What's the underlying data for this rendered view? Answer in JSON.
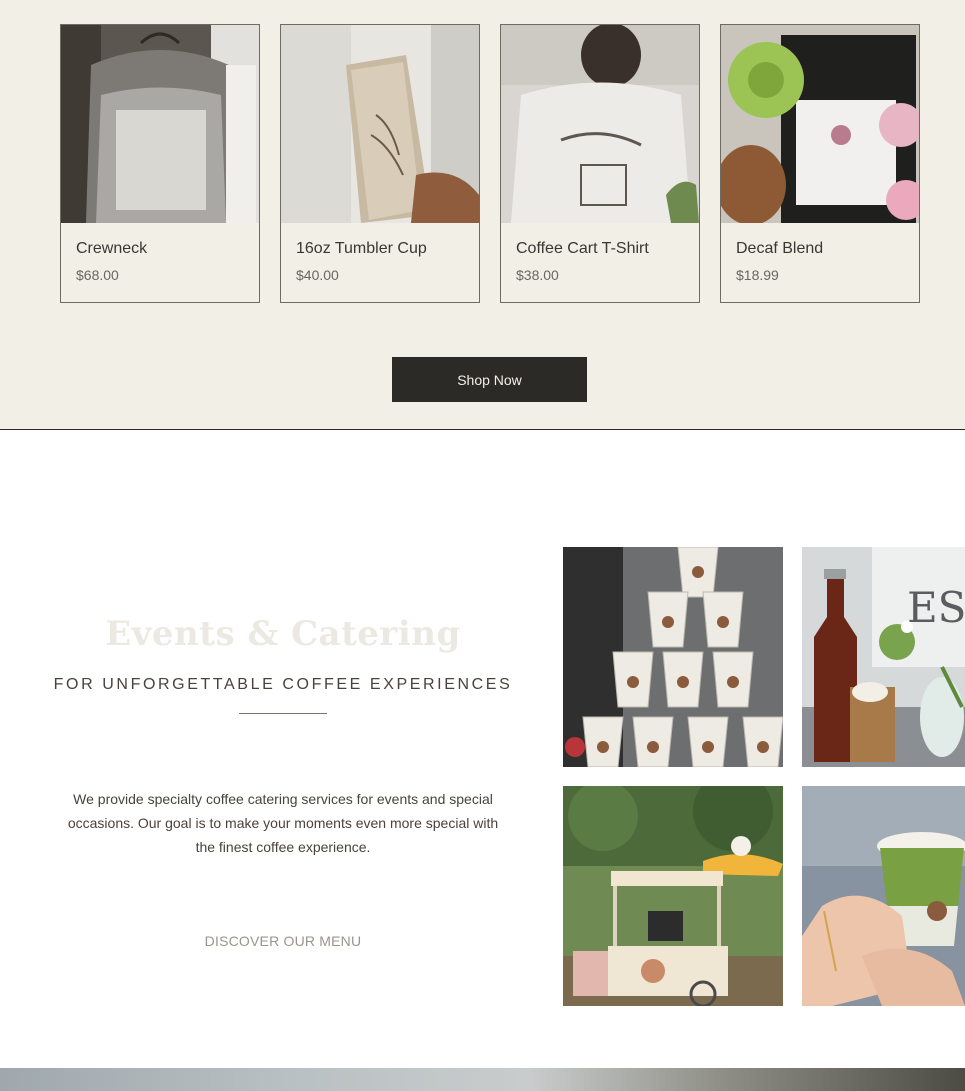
{
  "products": [
    {
      "name": "Crewneck",
      "price": "$68.00",
      "image": "gray crewneck sweatshirt on hanger"
    },
    {
      "name": "16oz Tumbler Cup",
      "price": "$40.00",
      "image": "cream tumbler held in hand"
    },
    {
      "name": "Coffee Cart T-Shirt",
      "price": "$38.00",
      "image": "white t-shirt with coffee cart print"
    },
    {
      "name": "Decaf Blend",
      "price": "$18.99",
      "image": "coffee bag with flowers"
    }
  ],
  "shop_button": {
    "label": "Shop Now"
  },
  "events": {
    "title": "Events & Catering",
    "subtitle": "FOR UNFORGETTABLE COFFEE EXPERIENCES",
    "body": "We provide specialty coffee catering services for events and special occasions. Our goal is to make your moments even more special with the finest coffee experience.",
    "link_label": "DISCOVER OUR MENU"
  },
  "gallery": [
    {
      "image": "stacked branded coffee cups"
    },
    {
      "image": "bottle and iced coffee on table"
    },
    {
      "image": "coffee cart with umbrella in garden"
    },
    {
      "image": "hands holding matcha latte"
    }
  ],
  "colors": {
    "band_background": "#f2efe7",
    "button_dark": "#2b2a27",
    "text_brown": "#4a423c"
  }
}
